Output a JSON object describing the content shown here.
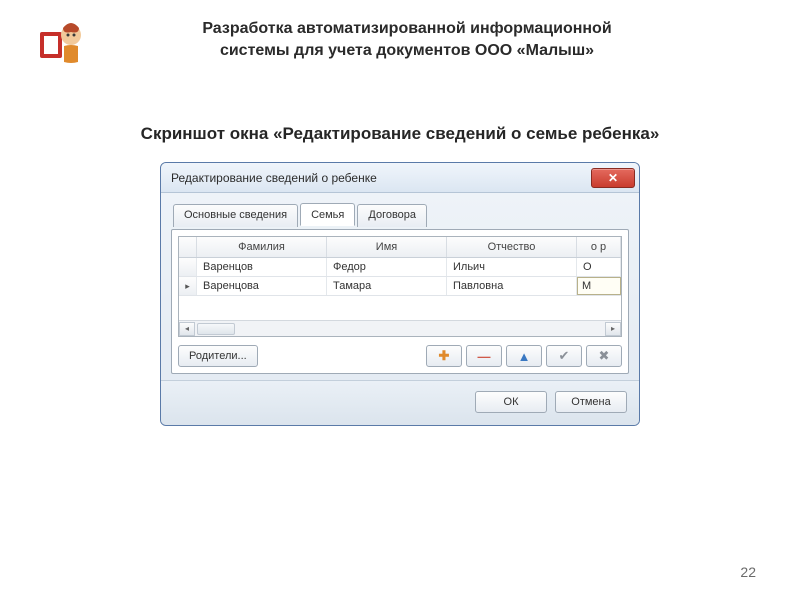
{
  "slide": {
    "title_line1": "Разработка автоматизированной информационной",
    "title_line2": "системы для учета документов ООО «Малыш»",
    "subtitle": "Скриншот окна «Редактирование сведений о семье ребенка»",
    "page_number": "22"
  },
  "dialog": {
    "title": "Редактирование сведений о ребенке",
    "tabs": [
      {
        "label": "Основные сведения",
        "active": false
      },
      {
        "label": "Семья",
        "active": true
      },
      {
        "label": "Договора",
        "active": false
      }
    ],
    "grid": {
      "columns": [
        "Фамилия",
        "Имя",
        "Отчество",
        "о р"
      ],
      "rows": [
        {
          "indicator": "",
          "cells": [
            "Варенцов",
            "Федор",
            "Ильич",
            "О"
          ]
        },
        {
          "indicator": "current",
          "cells": [
            "Варенцова",
            "Тамара",
            "Павловна",
            "М"
          ]
        }
      ]
    },
    "parents_button": "Родители...",
    "nav_icons": {
      "add": "✚",
      "delete": "—",
      "edit": "▲",
      "post": "✔",
      "cancel": "✖"
    },
    "footer": {
      "ok": "ОК",
      "cancel": "Отмена"
    }
  }
}
